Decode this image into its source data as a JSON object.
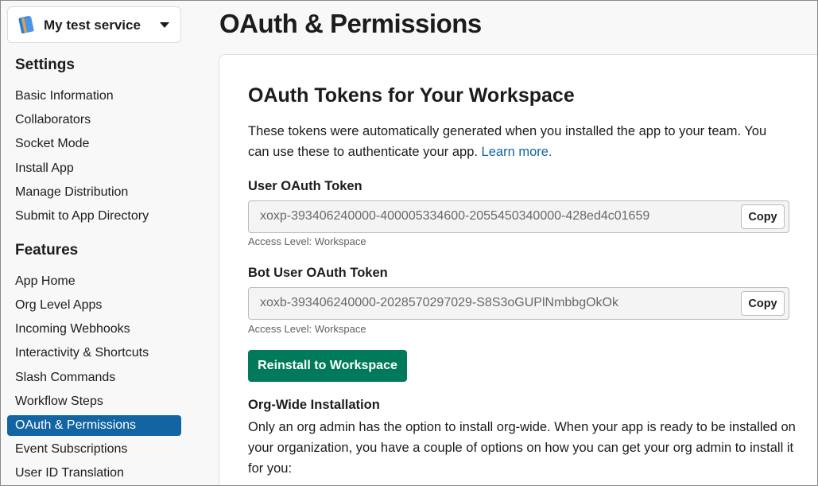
{
  "app_switcher": {
    "name": "My test service",
    "icon": "notebook-icon"
  },
  "sidebar": {
    "settings_title": "Settings",
    "settings_items": [
      {
        "label": "Basic Information"
      },
      {
        "label": "Collaborators"
      },
      {
        "label": "Socket Mode"
      },
      {
        "label": "Install App"
      },
      {
        "label": "Manage Distribution"
      },
      {
        "label": "Submit to App Directory"
      }
    ],
    "features_title": "Features",
    "features_items": [
      {
        "label": "App Home"
      },
      {
        "label": "Org Level Apps"
      },
      {
        "label": "Incoming Webhooks"
      },
      {
        "label": "Interactivity & Shortcuts"
      },
      {
        "label": "Slash Commands"
      },
      {
        "label": "Workflow Steps"
      },
      {
        "label": "OAuth & Permissions",
        "active": true
      },
      {
        "label": "Event Subscriptions"
      },
      {
        "label": "User ID Translation"
      }
    ]
  },
  "page": {
    "title": "OAuth & Permissions"
  },
  "tokens_card": {
    "title": "OAuth Tokens for Your Workspace",
    "description": "These tokens were automatically generated when you installed the app to your team. You can use these to authenticate your app.",
    "learn_more": "Learn more.",
    "user_token": {
      "label": "User OAuth Token",
      "value": "xoxp-393406240000-400005334600-2055450340000-428ed4c01659",
      "copy_label": "Copy",
      "access_level": "Access Level: Workspace"
    },
    "bot_token": {
      "label": "Bot User OAuth Token",
      "value": "xoxb-393406240000-2028570297029-S8S3oGUPlNmbbgOkOk",
      "copy_label": "Copy",
      "access_level": "Access Level: Workspace"
    },
    "reinstall_button": "Reinstall to Workspace",
    "org_wide": {
      "title": "Org-Wide Installation",
      "text": "Only an org admin has the option to install org-wide. When your app is ready to be installed on your organization, you have a couple of options on how you can get your org admin to install it for you:"
    }
  },
  "colors": {
    "accent": "#1264a3",
    "primary_button": "#007a5a",
    "text": "#1d1c1d",
    "muted_text": "#616061"
  }
}
